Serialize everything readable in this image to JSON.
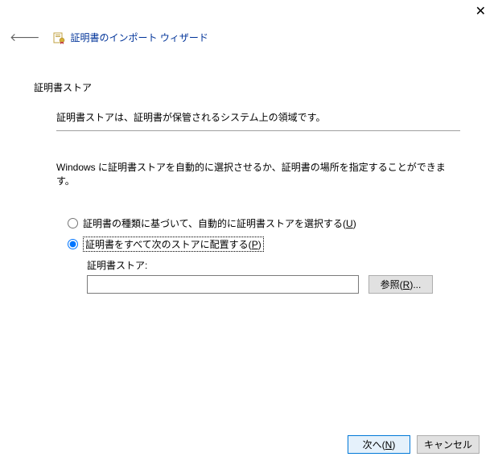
{
  "close_glyph": "✕",
  "back_glyph": "🡐",
  "wizard_title": "証明書のインポート ウィザード",
  "section_title": "証明書ストア",
  "description": "証明書ストアは、証明書が保管されるシステム上の領域です。",
  "instruction": "Windows に証明書ストアを自動的に選択させるか、証明書の場所を指定することができます。",
  "radio": {
    "auto_prefix": "証明書の種類に基づいて、自動的に証明書ストアを選択する(",
    "auto_key": "U",
    "auto_suffix": ")",
    "place_prefix": "証明書をすべて次のストアに配置する(",
    "place_key": "P",
    "place_suffix": ")",
    "selected": "place"
  },
  "store": {
    "label": "証明書ストア:",
    "value": ""
  },
  "browse": {
    "prefix": "参照(",
    "key": "R",
    "suffix": ")..."
  },
  "footer": {
    "next_prefix": "次へ(",
    "next_key": "N",
    "next_suffix": ")",
    "cancel": "キャンセル"
  }
}
